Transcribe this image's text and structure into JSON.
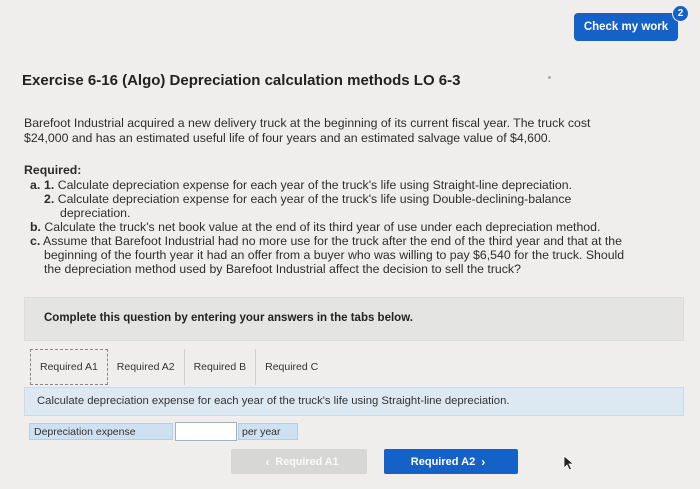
{
  "header": {
    "check_label": "Check my work",
    "badge_count": "2"
  },
  "exercise": {
    "title": "Exercise 6-16 (Algo) Depreciation calculation methods LO 6-3",
    "intro_line1": "Barefoot Industrial acquired a new delivery truck at the beginning of its current fiscal year. The truck cost",
    "intro_line2": "$24,000 and has an estimated useful life of four years and an estimated salvage value of $4,600."
  },
  "required": {
    "heading": "Required:",
    "a_marker": "a.",
    "a1_marker": "1.",
    "a1_text": "Calculate depreciation expense for each year of the truck's life using Straight-line depreciation.",
    "a2_marker": "2.",
    "a2_text_line1": "Calculate depreciation expense for each year of the truck's life using Double-declining-balance",
    "a2_text_line2": "depreciation.",
    "b_marker": "b.",
    "b_text": "Calculate the truck's net book value at the end of its third year of use under each depreciation method.",
    "c_marker": "c.",
    "c_text_line1": "Assume that Barefoot Industrial had no more use for the truck after the end of the third year and that at the",
    "c_text_line2": "beginning of the fourth year it had an offer from a buyer who was willing to pay $6,540 for the truck. Should",
    "c_text_line3": "the depreciation method used by Barefoot Industrial affect the decision to sell the truck?"
  },
  "complete_prompt": "Complete this question by entering your answers in the tabs below.",
  "tabs": [
    {
      "label": "Required A1",
      "active": true
    },
    {
      "label": "Required A2",
      "active": false
    },
    {
      "label": "Required B",
      "active": false
    },
    {
      "label": "Required C",
      "active": false
    }
  ],
  "instruction": "Calculate depreciation expense for each year of the truck's life using Straight-line depreciation.",
  "answer_row": {
    "label": "Depreciation expense",
    "value": "",
    "unit": "per year"
  },
  "navigation": {
    "prev_label": "Required A1",
    "next_label": "Required A2",
    "prev_icon": "chevron-left-icon",
    "next_icon": "chevron-right-icon"
  },
  "colors": {
    "accent": "#1462c8",
    "instruction_bg": "#dde9f2",
    "cell_bg": "#cfe0f0"
  }
}
